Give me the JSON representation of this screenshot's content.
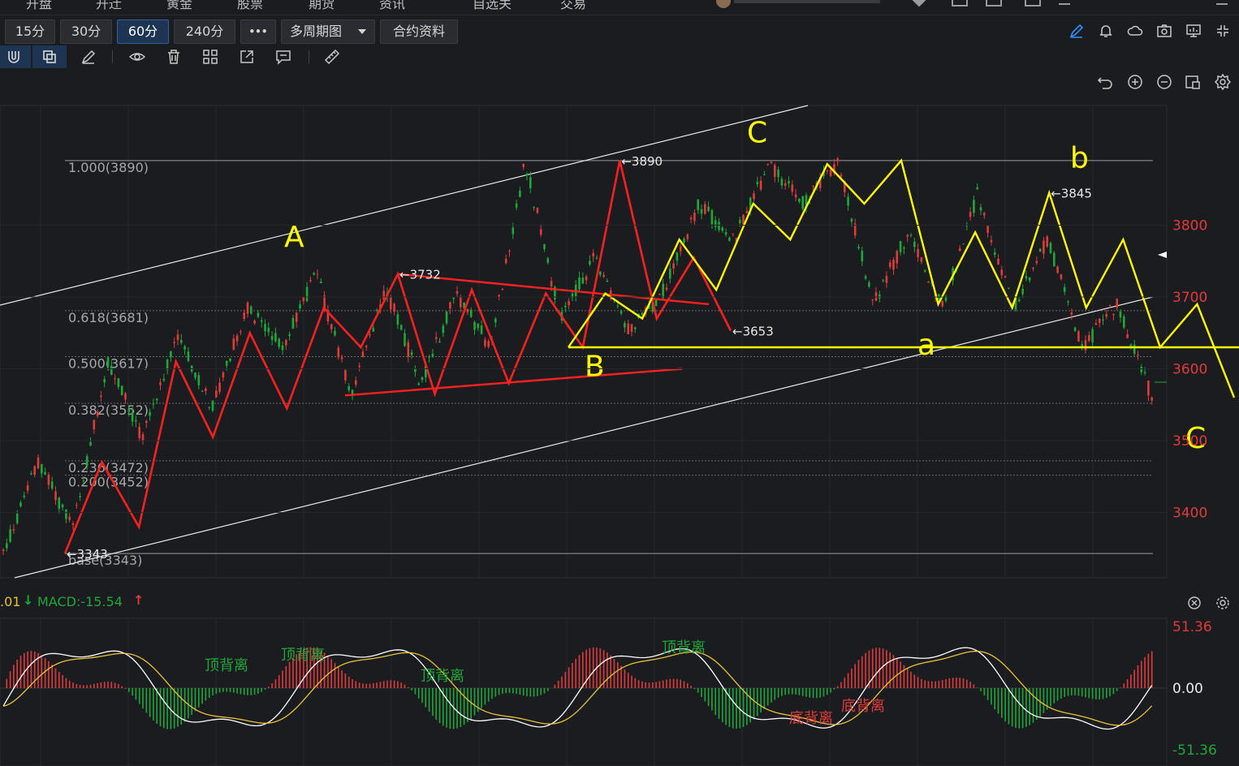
{
  "topbar": {
    "items": [
      "开盘",
      "开迁",
      "黄金",
      "股票",
      "期货",
      "资讯",
      "自选关",
      "交易"
    ]
  },
  "toolbar": {
    "periods": [
      {
        "label": "15分",
        "active": false
      },
      {
        "label": "30分",
        "active": false
      },
      {
        "label": "60分",
        "active": true
      },
      {
        "label": "240分",
        "active": false
      }
    ],
    "more_label": "•••",
    "multi_period_label": "多周期图",
    "contract_info_label": "合约资料"
  },
  "colors": {
    "background": "#1b1c20",
    "up": "#e03b3b",
    "down": "#1fa83a",
    "accent_yellow": "#ffff00",
    "accent_red": "#ff2020",
    "price_axis": "#e03b3b",
    "channel": "#e8e8e8"
  },
  "chart_data": {
    "type": "candlestick",
    "price_ticks": [
      3800,
      3700,
      3600,
      3500,
      3400
    ],
    "ylim": [
      3325,
      3935
    ],
    "fibonacci_levels": [
      {
        "label": "1.000(3890)",
        "value": 3890
      },
      {
        "label": "0.618(3681)",
        "value": 3681
      },
      {
        "label": "0.500(3617)",
        "value": 3617
      },
      {
        "label": "0.382(3552)",
        "value": 3552
      },
      {
        "label": "0.236(3472)",
        "value": 3472
      },
      {
        "label": "0.200(3452)",
        "value": 3452
      },
      {
        "label": "base(3343)",
        "value": 3343
      }
    ],
    "price_labels": [
      {
        "text": "←3343",
        "value": 3343
      },
      {
        "text": "←3732",
        "value": 3732
      },
      {
        "text": "←3890",
        "value": 3890
      },
      {
        "text": "←3845",
        "value": 3845
      },
      {
        "text": "←3653",
        "value": 3653
      }
    ],
    "wave_labels": [
      "A",
      "B",
      "C",
      "a",
      "b",
      "C"
    ],
    "red_zigzag": [
      3343,
      3470,
      3380,
      3610,
      3505,
      3650,
      3545,
      3685,
      3630,
      3732,
      3565,
      3710,
      3580,
      3705,
      3630,
      3890,
      3670,
      3755,
      3653
    ],
    "yellow_zigzag": [
      3630,
      3705,
      3670,
      3780,
      3710,
      3830,
      3780,
      3885,
      3830,
      3890,
      3690,
      3790,
      3685,
      3845,
      3685,
      3780,
      3630,
      3690,
      3560
    ]
  },
  "macd": {
    "params_partial": ".01",
    "label": "MACD:-15.54",
    "macd_value": -15.54,
    "axis_labels": [
      "51.36",
      "0.00",
      "-51.36"
    ],
    "range": [
      -51.36,
      51.36
    ],
    "annotations": [
      "顶背离",
      "顶背离",
      "顶背离",
      "顶背离",
      "底背离",
      "底背离"
    ]
  }
}
